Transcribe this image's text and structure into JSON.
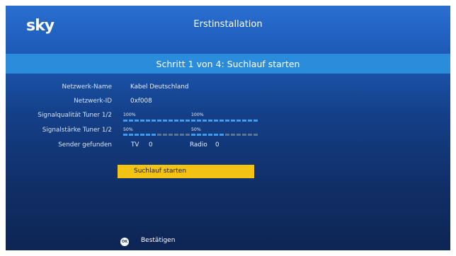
{
  "header": {
    "logo": "sky",
    "title": "Erstinstallation"
  },
  "step": {
    "title": "Schritt 1  von  4: Suchlauf starten"
  },
  "fields": {
    "network_name_label": "Netzwerk-Name",
    "network_name_value": "Kabel Deutschland",
    "network_id_label": "Netzwerk-ID",
    "network_id_value": "0xf008",
    "signal_quality_label": "Signalqualität Tuner 1/2",
    "signal_quality_tuner1": "100%",
    "signal_quality_tuner2": "100%",
    "signal_quality_levels": [
      1.0,
      1.0
    ],
    "signal_strength_label": "Signalstärke Tuner 1/2",
    "signal_strength_tuner1": "50%",
    "signal_strength_tuner2": "50%",
    "signal_strength_levels": [
      0.5,
      0.5
    ],
    "channels_found_label": "Sender gefunden",
    "tv_label": "TV",
    "tv_count": "0",
    "radio_label": "Radio",
    "radio_count": "0"
  },
  "actions": {
    "start_scan_label": "Suchlauf starten"
  },
  "footer": {
    "ok_icon_text": "OK",
    "confirm_label": "Bestätigen"
  },
  "colors": {
    "background_top": "#2a6fd0",
    "background_bottom": "#0d2554",
    "step_band": "#2a8cdb",
    "button": "#f2c313",
    "bar_on": "#3d9cf0",
    "bar_off": "#5d7494"
  },
  "icons": {
    "ok": "ok-button-icon"
  }
}
